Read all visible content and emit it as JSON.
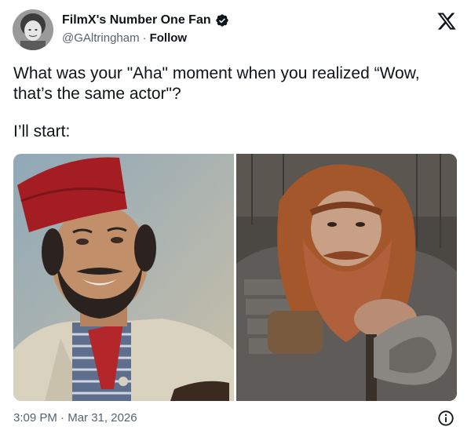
{
  "author": {
    "display_name": "FilmX's Number One Fan",
    "handle": "@GAltringham",
    "separator": "·",
    "follow_label": "Follow"
  },
  "tweet": {
    "line1": "What was your \"Aha\" moment when you realized “Wow, that’s the same actor\"?",
    "line2": "I’ll start:"
  },
  "media": {
    "count": 2
  },
  "footer": {
    "time": "3:09 PM",
    "separator": "·",
    "date": "Mar 31, 2026"
  },
  "colors": {
    "text": "#0f1419",
    "secondary": "#536471",
    "verified": "#0f1419"
  },
  "icons": [
    "verified-badge-icon",
    "x-logo-icon",
    "info-icon"
  ]
}
